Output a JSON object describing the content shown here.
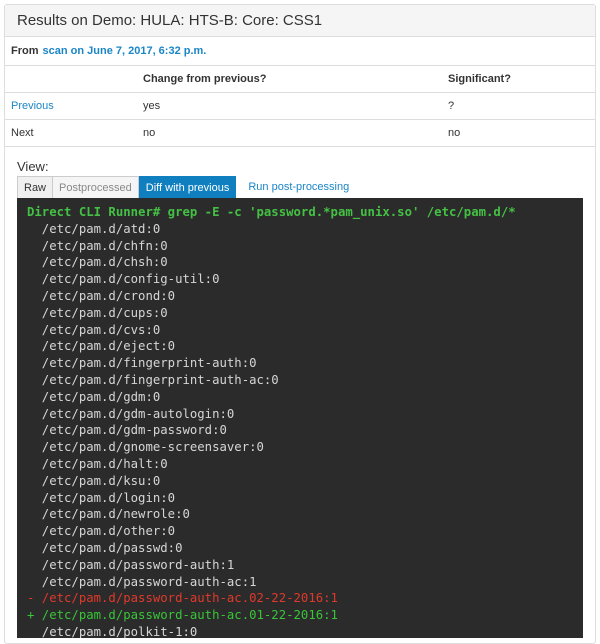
{
  "header": {
    "title": "Results on Demo: HULA: HTS-B: Core: CSS1"
  },
  "from": {
    "label": "From",
    "scan_link": "scan",
    "date_link": "on June 7, 2017, 6:32 p.m."
  },
  "compare_table": {
    "headers": [
      "",
      "Change from previous?",
      "Significant?"
    ],
    "rows": [
      {
        "name": "Previous",
        "change": "yes",
        "significant": "?"
      },
      {
        "name": "Next",
        "change": "no",
        "significant": "no"
      }
    ]
  },
  "view": {
    "label": "View:",
    "tabs": [
      "Raw",
      "Postprocessed",
      "Diff with previous"
    ],
    "active_tab": "Diff with previous",
    "action_link": "Run post-processing"
  },
  "terminal": {
    "command": "Direct CLI Runner# grep -E -c 'password.*pam_unix.so' /etc/pam.d/*",
    "lines": [
      {
        "type": "context",
        "text": "  /etc/pam.d/atd:0"
      },
      {
        "type": "context",
        "text": "  /etc/pam.d/chfn:0"
      },
      {
        "type": "context",
        "text": "  /etc/pam.d/chsh:0"
      },
      {
        "type": "context",
        "text": "  /etc/pam.d/config-util:0"
      },
      {
        "type": "context",
        "text": "  /etc/pam.d/crond:0"
      },
      {
        "type": "context",
        "text": "  /etc/pam.d/cups:0"
      },
      {
        "type": "context",
        "text": "  /etc/pam.d/cvs:0"
      },
      {
        "type": "context",
        "text": "  /etc/pam.d/eject:0"
      },
      {
        "type": "context",
        "text": "  /etc/pam.d/fingerprint-auth:0"
      },
      {
        "type": "context",
        "text": "  /etc/pam.d/fingerprint-auth-ac:0"
      },
      {
        "type": "context",
        "text": "  /etc/pam.d/gdm:0"
      },
      {
        "type": "context",
        "text": "  /etc/pam.d/gdm-autologin:0"
      },
      {
        "type": "context",
        "text": "  /etc/pam.d/gdm-password:0"
      },
      {
        "type": "context",
        "text": "  /etc/pam.d/gnome-screensaver:0"
      },
      {
        "type": "context",
        "text": "  /etc/pam.d/halt:0"
      },
      {
        "type": "context",
        "text": "  /etc/pam.d/ksu:0"
      },
      {
        "type": "context",
        "text": "  /etc/pam.d/login:0"
      },
      {
        "type": "context",
        "text": "  /etc/pam.d/newrole:0"
      },
      {
        "type": "context",
        "text": "  /etc/pam.d/other:0"
      },
      {
        "type": "context",
        "text": "  /etc/pam.d/passwd:0"
      },
      {
        "type": "context",
        "text": "  /etc/pam.d/password-auth:1"
      },
      {
        "type": "context",
        "text": "  /etc/pam.d/password-auth-ac:1"
      },
      {
        "type": "del",
        "text": "- /etc/pam.d/password-auth-ac.02-22-2016:1"
      },
      {
        "type": "add",
        "text": "+ /etc/pam.d/password-auth-ac.01-22-2016:1"
      },
      {
        "type": "context",
        "text": "  /etc/pam.d/polkit-1:0"
      }
    ]
  }
}
